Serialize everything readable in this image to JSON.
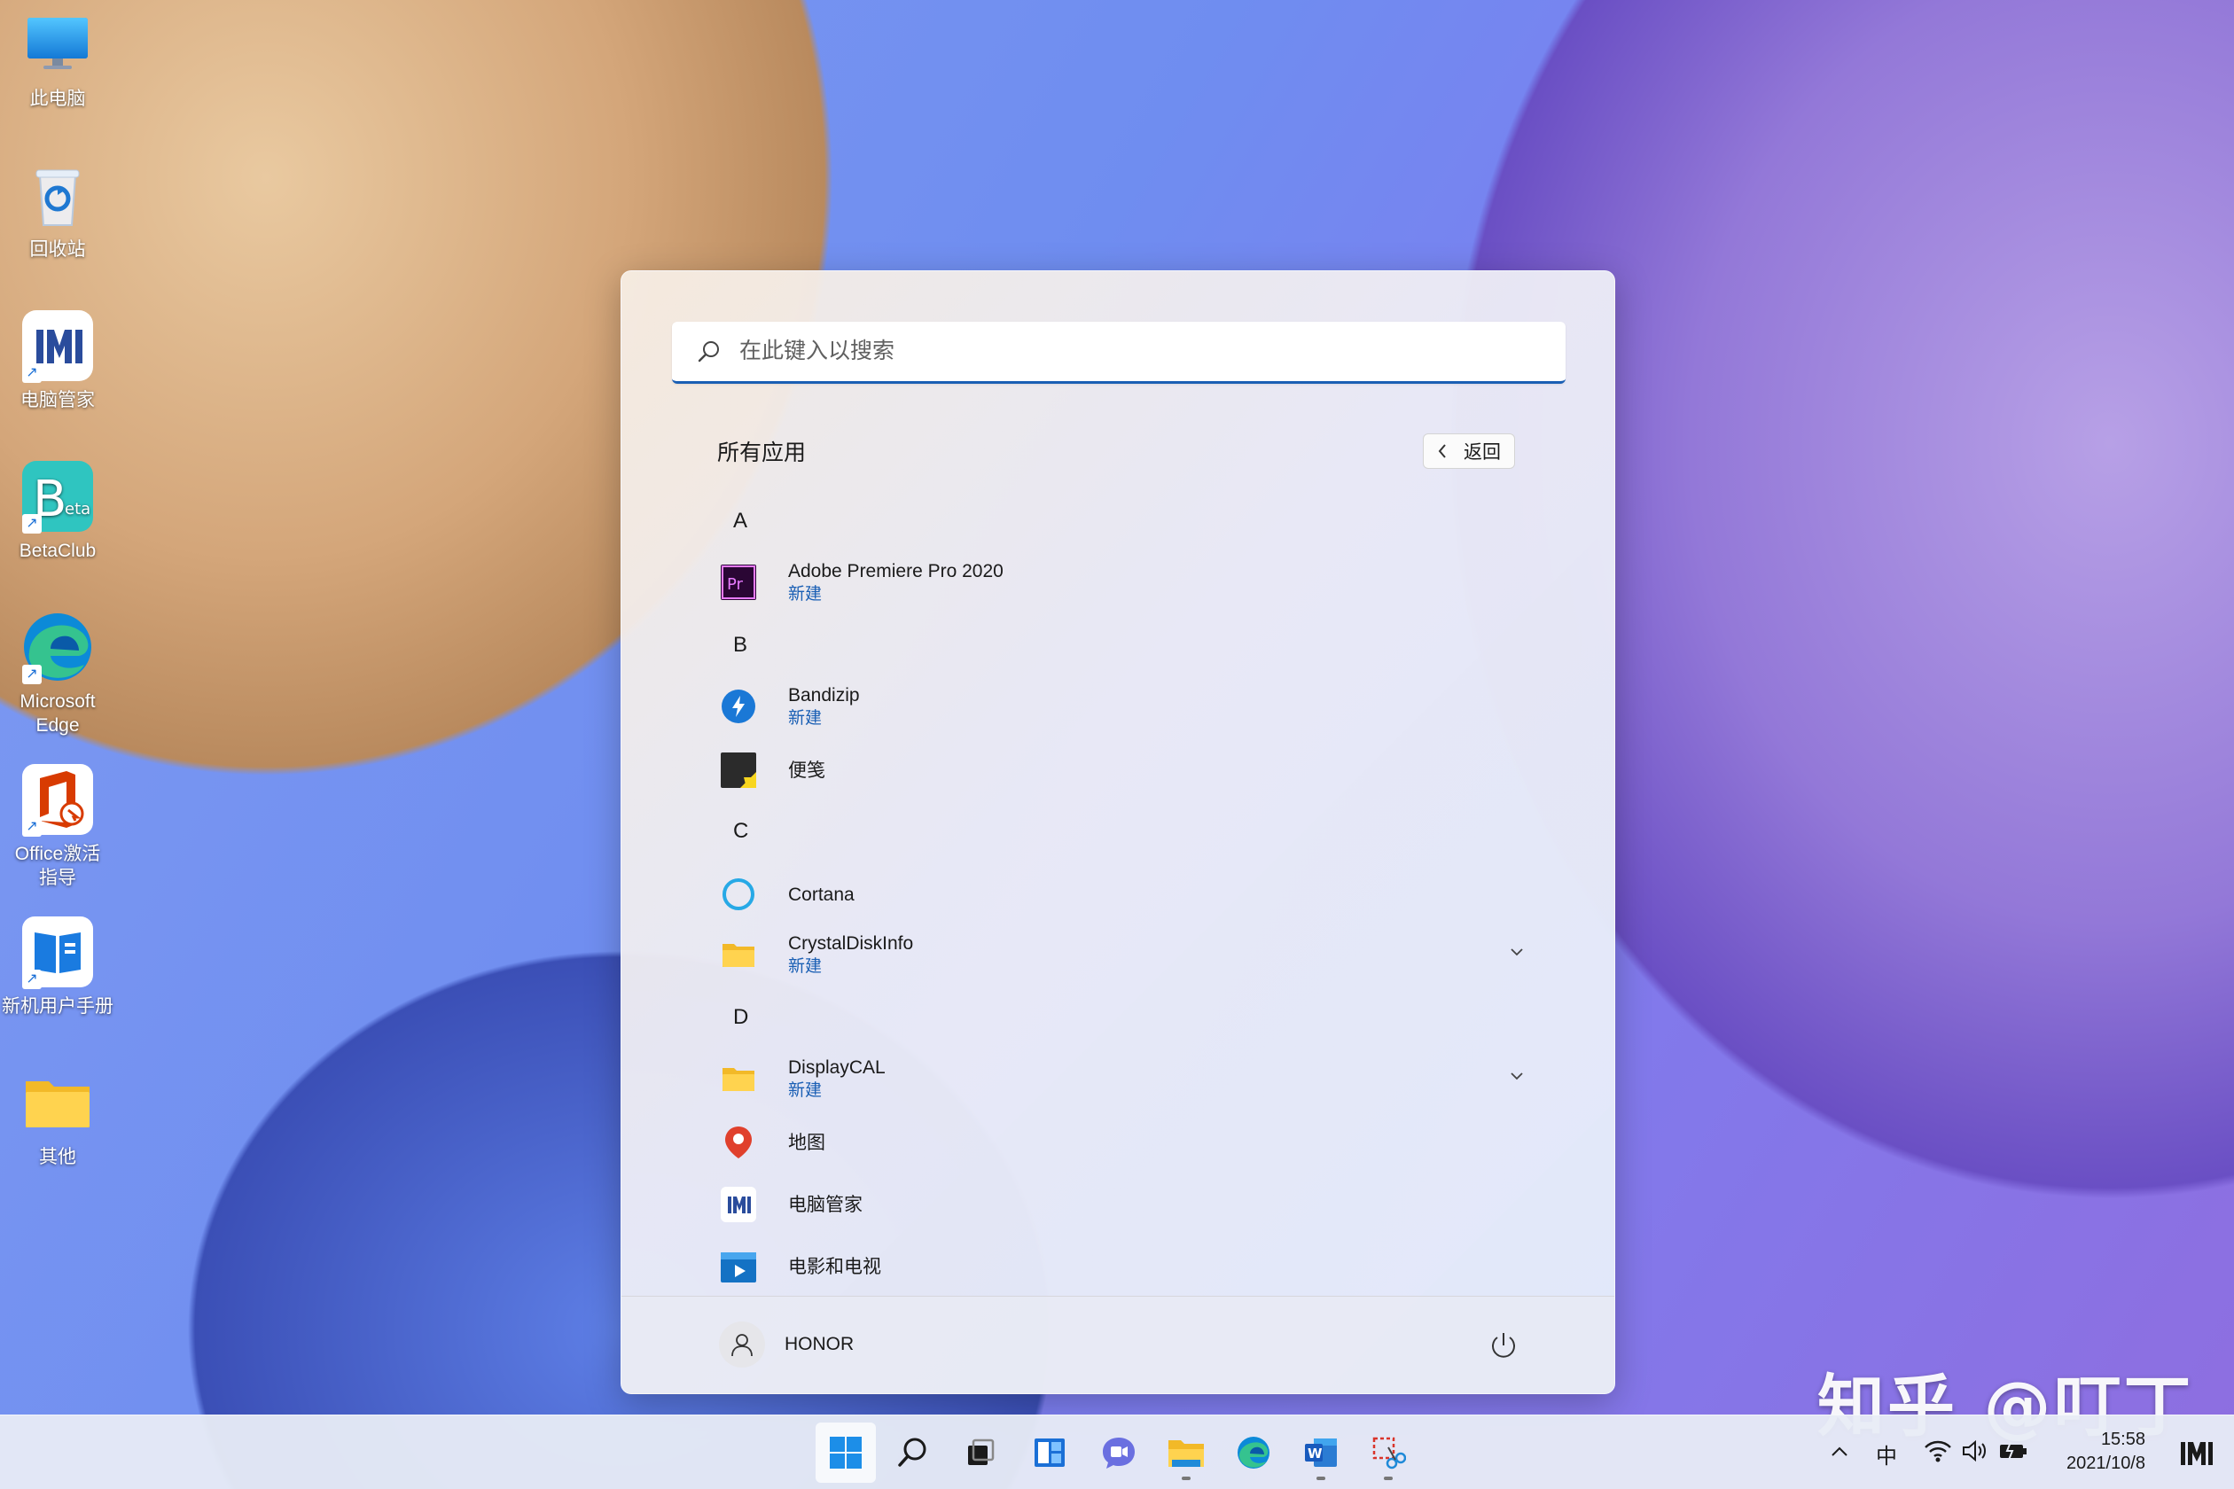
{
  "desktop": {
    "icons": [
      {
        "label": "此电脑",
        "icon": "monitor-icon"
      },
      {
        "label": "回收站",
        "icon": "recycle-bin-icon"
      },
      {
        "label": "电脑管家",
        "icon": "pc-manager-icon"
      },
      {
        "label": "BetaClub",
        "icon": "betaclub-icon"
      },
      {
        "label": "Microsoft Edge",
        "icon": "edge-icon"
      },
      {
        "label": "Office激活指导",
        "icon": "office-icon"
      },
      {
        "label": "新机用户手册",
        "icon": "manual-icon"
      },
      {
        "label": "其他",
        "icon": "folder-icon"
      }
    ]
  },
  "start_menu": {
    "search": {
      "placeholder": "在此键入以搜索"
    },
    "section_title": "所有应用",
    "back_label": "返回",
    "letters": [
      "A",
      "B",
      "C",
      "D"
    ],
    "apps": [
      {
        "name": "Adobe Premiere Pro 2020",
        "sub": "新建",
        "icon": "premiere-icon"
      },
      {
        "name": "Bandizip",
        "sub": "新建",
        "icon": "bandizip-icon"
      },
      {
        "name": "便笺",
        "sub": "",
        "icon": "sticky-notes-icon"
      },
      {
        "name": "Cortana",
        "sub": "",
        "icon": "cortana-icon"
      },
      {
        "name": "CrystalDiskInfo",
        "sub": "新建",
        "icon": "folder-icon"
      },
      {
        "name": "DisplayCAL",
        "sub": "新建",
        "icon": "folder-icon"
      },
      {
        "name": "地图",
        "sub": "",
        "icon": "maps-icon"
      },
      {
        "name": "电脑管家",
        "sub": "",
        "icon": "pc-manager-icon"
      },
      {
        "name": "电影和电视",
        "sub": "",
        "icon": "movies-tv-icon"
      }
    ],
    "user_name": "HONOR"
  },
  "taskbar": {
    "apps": [
      "start-icon",
      "search-icon",
      "task-view-icon",
      "widgets-icon",
      "chat-icon",
      "file-explorer-icon",
      "edge-icon",
      "word-icon",
      "snipping-tool-icon"
    ],
    "ime": "中",
    "time": "15:58",
    "date": "2021/10/8"
  },
  "watermark": "知乎 @叮丁",
  "colors": {
    "accent": "#1a5fb4",
    "taskbar": "#e8ecf6"
  }
}
